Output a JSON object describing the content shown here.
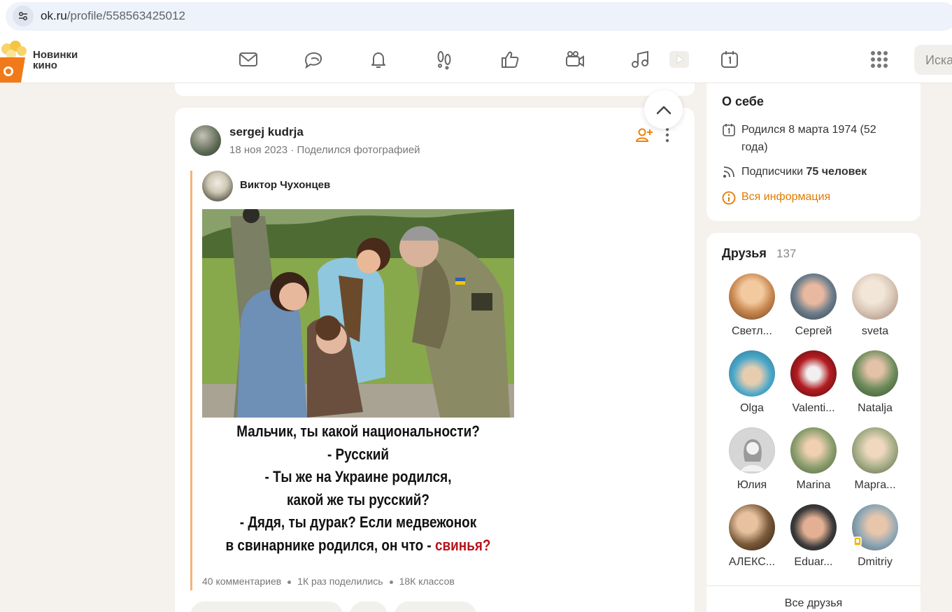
{
  "browser": {
    "url_host": "ok.ru",
    "url_path": "/profile/558563425012"
  },
  "header": {
    "promo_line1": "Новинки",
    "promo_line2": "кино",
    "nav_icons": [
      "envelope-icon",
      "chat-bubbles-icon",
      "bell-icon",
      "footprints-icon",
      "thumbs-up-icon",
      "video-camera-icon",
      "music-note-icon",
      "play-icon",
      "calendar-icon",
      "apps-grid-icon"
    ],
    "search_placeholder": "Иска"
  },
  "post": {
    "author": "sergej kudrja",
    "date": "18 ноя 2023",
    "action": "Поделился фотографией",
    "original_author": "Виктор Чухонцев",
    "caption_lines": [
      "Мальчик, ты какой национальности?",
      "- Русский",
      "- Ты же на Украине родился,",
      "какой же ты русский?",
      "- Дядя, ты дурак? Если медвежонок"
    ],
    "caption_last_prefix": "в свинарнике родился, он что - ",
    "caption_last_red": "свинья?",
    "stats": {
      "comments": "40 комментариев",
      "shares": "1К раз поделились",
      "likes": "18К классов"
    }
  },
  "about": {
    "title": "О себе",
    "born": "Родился 8 марта 1974 (52 года)",
    "subscribers_prefix": "Подписчики",
    "subscribers_value": "75 человек",
    "all_info": "Вся информация"
  },
  "friends": {
    "title": "Друзья",
    "count": "137",
    "items": [
      {
        "name": "Светл...",
        "color": "#c98a52"
      },
      {
        "name": "Сергей",
        "color": "#6f7f8c"
      },
      {
        "name": "sveta",
        "color": "#d9c6b6"
      },
      {
        "name": "Olga",
        "color": "#4aa7c9"
      },
      {
        "name": "Valenti...",
        "color": "#b31d22"
      },
      {
        "name": "Natalja",
        "color": "#6c8c5a"
      },
      {
        "name": "Юлия",
        "color": "#d6d6d6"
      },
      {
        "name": "Marina",
        "color": "#8ea070"
      },
      {
        "name": "Марга...",
        "color": "#a9b08a"
      },
      {
        "name": "АЛЕКС...",
        "color": "#7a5a3a"
      },
      {
        "name": "Eduar...",
        "color": "#3c3c3c"
      },
      {
        "name": "Dmitriy",
        "color": "#8fa7b5"
      }
    ],
    "all_label": "Все друзья"
  }
}
